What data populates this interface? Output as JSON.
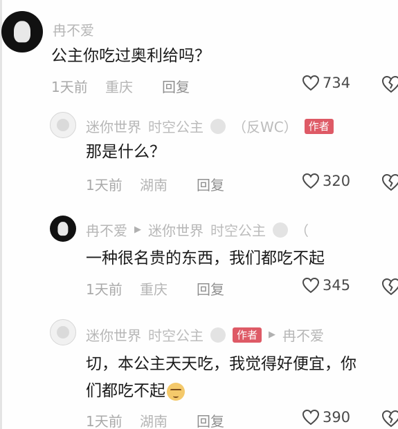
{
  "comments": [
    {
      "username": "冉不爱",
      "text": "公主你吃过奥利给吗？",
      "time": "1天前",
      "location": "重庆",
      "reply_label": "回复",
      "likes": "734"
    },
    {
      "username": "迷你世界",
      "tag": "时空公主",
      "suffix": "（反WC）",
      "badge": "作者",
      "text": "那是什么？",
      "time": "1天前",
      "location": "湖南",
      "reply_label": "回复",
      "likes": "320"
    },
    {
      "username": "冉不爱",
      "arrow": "▶",
      "reply_to": "迷你世界",
      "tag": "时空公主",
      "suffix": "（",
      "text": "一种很名贵的东西，我们都吃不起",
      "time": "1天前",
      "location": "重庆",
      "reply_label": "回复",
      "likes": "345"
    },
    {
      "username": "迷你世界",
      "tag": "时空公主",
      "badge": "作者",
      "arrow": "▶",
      "reply_to": "冉不爱",
      "text_line1": "切，本公主天天吃，我觉得好便宜，你",
      "text_line2": "们都吃不起",
      "time": "1天前",
      "location": "湖南",
      "reply_label": "回复",
      "likes": "390"
    }
  ],
  "icons": {
    "like": "heart-outline-icon",
    "dislike": "broken-heart-icon",
    "emoji": "smirk-emoji-icon"
  },
  "colors": {
    "author_badge": "#de5a66",
    "username": "#b6b6b6",
    "text": "#1a1a1a",
    "meta": "#a9a9a9"
  }
}
